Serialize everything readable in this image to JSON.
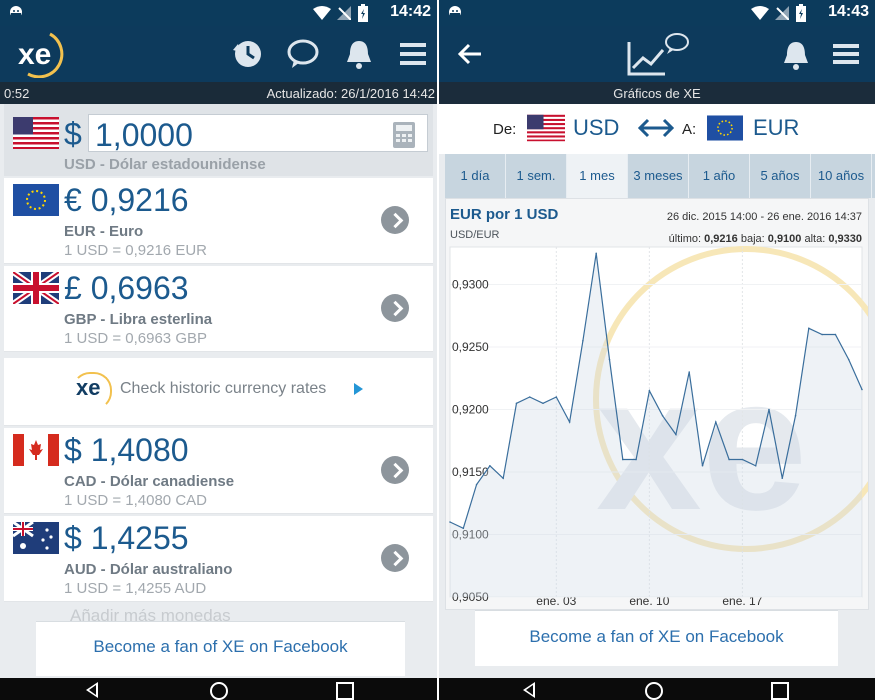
{
  "colors": {
    "header": "#0d3a5c",
    "accent": "#1c5a8e",
    "link": "#2c6fad"
  },
  "left": {
    "status": {
      "time": "14:42"
    },
    "header": {
      "logo": "xe",
      "icons": [
        "clock-refresh-icon",
        "chat-bubble-icon",
        "bell-icon",
        "menu-icon"
      ]
    },
    "subbar": {
      "left": "0:52",
      "right": "Actualizado: 26/1/2016 14:42"
    },
    "base": {
      "flag": "us-flag",
      "symbol": "$",
      "amount": "1,0000",
      "name": "USD - Dólar estadounidense"
    },
    "rows": [
      {
        "flag": "eu-flag",
        "value": "€ 0,9216",
        "name": "EUR - Euro",
        "rate": "1 USD = 0,9216 EUR"
      },
      {
        "flag": "uk-flag",
        "value": "£ 0,6963",
        "name": "GBP - Libra esterlina",
        "rate": "1 USD = 0,6963 GBP"
      },
      {
        "flag": "ca-flag",
        "value": "$ 1,4080",
        "name": "CAD - Dólar canadiense",
        "rate": "1 USD = 1,4080 CAD"
      },
      {
        "flag": "au-flag",
        "value": "$ 1,4255",
        "name": "AUD - Dólar australiano",
        "rate": "1 USD = 1,4255 AUD"
      }
    ],
    "historic": {
      "logo": "xe",
      "text": "Check historic currency rates"
    },
    "add_more": "Añadir más monedas",
    "facebook": "Become a fan of XE on Facebook"
  },
  "right": {
    "status": {
      "time": "14:43"
    },
    "subtitle": "Gráficos de XE",
    "pair": {
      "from_label": "De:",
      "from": "USD",
      "to_label": "A:",
      "to": "EUR"
    },
    "tabs": [
      {
        "label": "1 día",
        "active": false
      },
      {
        "label": "1 sem.",
        "active": false
      },
      {
        "label": "1 mes",
        "active": true
      },
      {
        "label": "3 meses",
        "active": false
      },
      {
        "label": "1 año",
        "active": false
      },
      {
        "label": "5 años",
        "active": false
      },
      {
        "label": "10 años",
        "active": false
      }
    ],
    "chart_header": {
      "title": "EUR por 1 USD",
      "pair": "USD/EUR",
      "range": "26 dic. 2015 14:00 - 26 ene. 2016 14:37",
      "last_label": "último:",
      "last": "0,9216",
      "low_label": "baja:",
      "low": "0,9100",
      "high_label": "alta:",
      "high": "0,9330"
    },
    "facebook": "Become a fan of XE on Facebook"
  },
  "chart_data": {
    "type": "line",
    "title": "EUR por 1 USD",
    "series": [
      {
        "name": "USD/EUR",
        "x": [
          "2015-12-26",
          "2015-12-27",
          "2015-12-28",
          "2015-12-29",
          "2015-12-30",
          "2015-12-31",
          "2016-01-01",
          "2016-01-02",
          "2016-01-03",
          "2016-01-04",
          "2016-01-05",
          "2016-01-06",
          "2016-01-07",
          "2016-01-08",
          "2016-01-09",
          "2016-01-10",
          "2016-01-11",
          "2016-01-12",
          "2016-01-13",
          "2016-01-14",
          "2016-01-15",
          "2016-01-16",
          "2016-01-17",
          "2016-01-18",
          "2016-01-19",
          "2016-01-20",
          "2016-01-21",
          "2016-01-22",
          "2016-01-23",
          "2016-01-24",
          "2016-01-25",
          "2016-01-26"
        ],
        "values": [
          0.911,
          0.9105,
          0.914,
          0.9155,
          0.9145,
          0.9205,
          0.921,
          0.9205,
          0.921,
          0.919,
          0.9255,
          0.9325,
          0.924,
          0.916,
          0.916,
          0.9215,
          0.9195,
          0.918,
          0.923,
          0.9155,
          0.919,
          0.916,
          0.916,
          0.9155,
          0.92,
          0.9145,
          0.9195,
          0.9265,
          0.926,
          0.926,
          0.924,
          0.9216
        ]
      }
    ],
    "y_ticks": [
      "0,9300",
      "0,9250",
      "0,9200",
      "0,9150",
      "0,9100",
      "0,9050"
    ],
    "x_ticks": [
      "ene. 03",
      "ene. 10",
      "ene. 17"
    ],
    "ylim": [
      0.905,
      0.933
    ],
    "grid": true
  }
}
